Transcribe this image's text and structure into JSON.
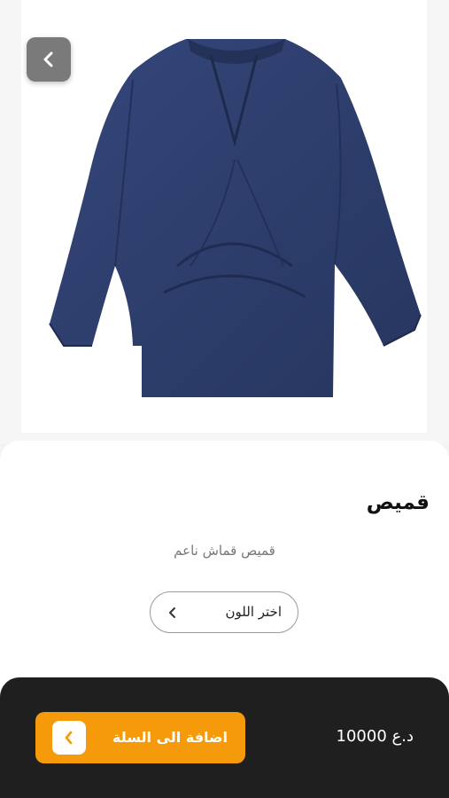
{
  "product": {
    "image_icon": "navy-blouse-image",
    "title": "قميص",
    "description": "قميص قماش ناعم"
  },
  "color_select": {
    "label": "اختر اللون",
    "icon": "chevron-left-icon"
  },
  "footer": {
    "price": "10000 د.ع",
    "add_to_cart_label": "اضافة الى السلة",
    "add_to_cart_icon": "chevron-left-icon"
  },
  "colors": {
    "accent": "#f59a0b",
    "footer_bg": "#1f1f1f",
    "shirt": "#2e3e6b"
  }
}
